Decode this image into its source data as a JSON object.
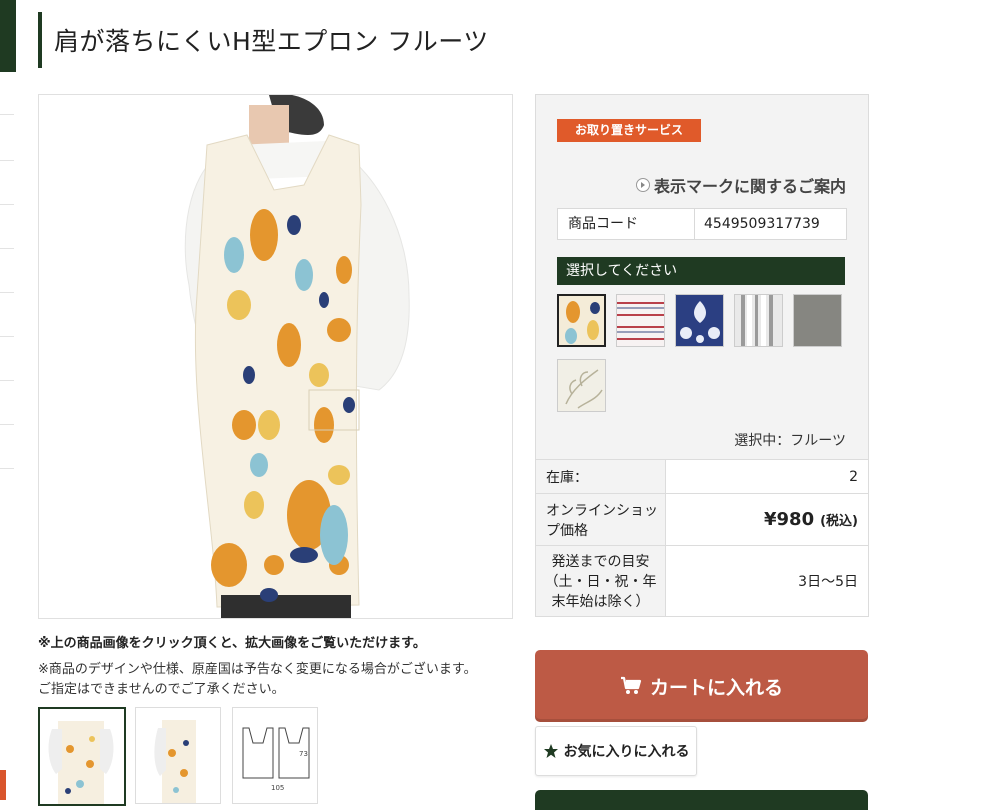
{
  "page": {
    "title": "肩が落ちにくいH型エプロン フルーツ"
  },
  "notices": {
    "bold": "※上の商品画像をクリック頂くと、拡大画像をご覧いただけます。",
    "line1": "※商品のデザインや仕様、原産国は予告なく変更になる場合がございます。",
    "line2": "ご指定はできませんのでご了承ください。"
  },
  "thumbnail_labels": {
    "dim_width": "105",
    "dim_height": "73"
  },
  "panel": {
    "service_badge": "お取り置きサービス",
    "guide_link": "表示マークに関するご案内",
    "code_label": "商品コード",
    "code_value": "4549509317739",
    "select_prompt": "選択してください",
    "selected_label": "選択中：フルーツ"
  },
  "info": {
    "stock_label": "在庫：",
    "stock_value": "2",
    "price_label": "オンラインショップ価格",
    "price_value": "¥980",
    "price_tax": "(税込)",
    "ship_label": "発送までの目安（土・日・祝・年末年始は除く）",
    "ship_value": "3日〜5日"
  },
  "buttons": {
    "cart": "カートに入れる",
    "favorite": "お気に入りに入れる"
  },
  "colors": {
    "brand_green": "#1f3a22",
    "badge_orange": "#e05a2a",
    "cart_red": "#bd5a45"
  },
  "icons": {
    "cart": "cart-icon",
    "favorite": "star-icon",
    "guide": "play-circle-icon"
  }
}
